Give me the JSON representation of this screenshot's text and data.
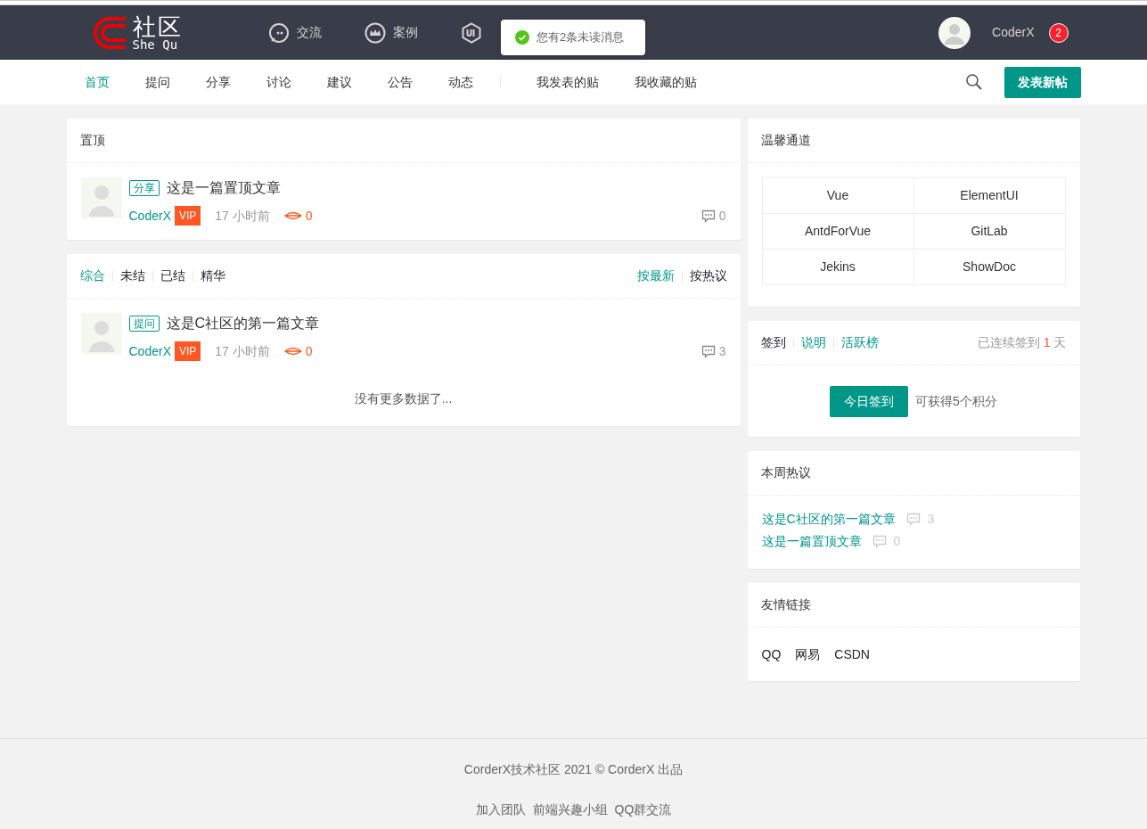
{
  "header": {
    "logo": {
      "title": "社区",
      "subtitle": "She Qu"
    },
    "nav": [
      {
        "label": "交流",
        "kind": "chat"
      },
      {
        "label": "案例",
        "kind": "crown"
      },
      {
        "kind": "hexagon"
      }
    ],
    "user": {
      "name": "CoderX",
      "unread": "2"
    },
    "toast": {
      "message": "您有2条未读消息"
    }
  },
  "subnav": {
    "items": [
      {
        "label": "首页",
        "selected": true
      },
      {
        "label": "提问",
        "selected": false
      },
      {
        "label": "分享",
        "selected": false
      },
      {
        "label": "讨论",
        "selected": false
      },
      {
        "label": "建议",
        "selected": false
      },
      {
        "label": "公告",
        "selected": false
      },
      {
        "label": "动态",
        "selected": false
      }
    ],
    "personal": [
      "我发表的贴",
      "我收藏的贴"
    ],
    "post_button": "发表新帖"
  },
  "pinned": {
    "title": "置顶",
    "posts": [
      {
        "tag": "分享",
        "title": "这是一篇置顶文章",
        "author": "CoderX",
        "badge": "VIP",
        "time": "17 小时前",
        "views": "0",
        "comments": "0"
      }
    ]
  },
  "feed": {
    "filters": [
      {
        "label": "综合",
        "selected": true
      },
      {
        "label": "未结",
        "selected": false
      },
      {
        "label": "已结",
        "selected": false
      },
      {
        "label": "精华",
        "selected": false
      }
    ],
    "sorts": [
      {
        "label": "按最新",
        "selected": true
      },
      {
        "label": "按热议",
        "selected": false
      }
    ],
    "posts": [
      {
        "tag": "提问",
        "title": "这是C社区的第一篇文章",
        "author": "CoderX",
        "badge": "VIP",
        "time": "17 小时前",
        "views": "0",
        "comments": "3"
      }
    ],
    "end_text": "没有更多数据了..."
  },
  "channels": {
    "title": "温馨通道",
    "links": [
      "Vue",
      "ElementUI",
      "AntdForVue",
      "GitLab",
      "Jekins",
      "ShowDoc"
    ]
  },
  "signin": {
    "tabs": [
      {
        "label": "签到",
        "selected": true
      },
      {
        "label": "说明",
        "selected": false
      },
      {
        "label": "活跃榜",
        "selected": false
      }
    ],
    "streak_prefix": "已连续签到",
    "streak_days": "1",
    "streak_suffix": "天",
    "button": "今日签到",
    "reward": "可获得5个积分"
  },
  "hot": {
    "title": "本周热议",
    "items": [
      {
        "title": "这是C社区的第一篇文章",
        "comments": "3"
      },
      {
        "title": "这是一篇置顶文章",
        "comments": "0"
      }
    ]
  },
  "friends": {
    "title": "友情链接",
    "links": [
      "QQ",
      "网易",
      "CSDN"
    ]
  },
  "footer": {
    "copyright": "CorderX技术社区 2021 © CorderX 出品",
    "links": [
      "加入团队",
      "前端兴趣小组",
      "QQ群交流"
    ]
  }
}
